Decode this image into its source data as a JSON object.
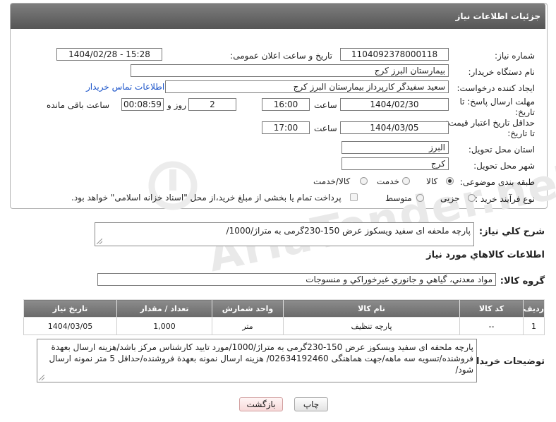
{
  "header": {
    "title": "جزئیات اطلاعات نیاز"
  },
  "fields": {
    "need_number_label": "شماره نیاز:",
    "need_number": "1104092378000118",
    "announce_label": "تاریخ و ساعت اعلان عمومی:",
    "announce_value": "1404/02/28 - 15:28",
    "buyer_org_label": "نام دستگاه خریدار:",
    "buyer_org": "بیمارستان البرز کرج",
    "creator_label": "ایجاد کننده درخواست:",
    "creator": "سعید سفیدگر کارپرداز بیمارستان البرز کرج",
    "contact_link": "اطلاعات تماس خریدار",
    "deadline_label_1": "مهلت ارسال پاسخ: تا",
    "deadline_label_2": "تاریخ:",
    "deadline_date": "1404/02/30",
    "time_label": "ساعت",
    "deadline_time": "16:00",
    "days_value": "2",
    "days_label": "روز و",
    "countdown": "00:08:59",
    "remaining_label": "ساعت باقی مانده",
    "min_price_label_1": "حداقل تاریخ اعتبار قیمت:",
    "min_price_label_2": "تا تاریخ:",
    "price_date": "1404/03/05",
    "price_time_label": "ساعت",
    "price_time": "17:00",
    "province_label": "استان محل تحویل:",
    "province": "البرز",
    "city_label": "شهر محل تحویل:",
    "city": "کرج",
    "category_label": "طبقه بندی موضوعی:",
    "category_options": [
      "کالا",
      "خدمت",
      "کالا/خدمت"
    ],
    "category_selected": "کالا",
    "process_label": "نوع فرآیند خرید :",
    "process_options": [
      "جزیی",
      "متوسط"
    ],
    "process_note": "پرداخت تمام یا بخشی از مبلغ خرید،از محل \"اسناد خزانه اسلامی\" خواهد بود."
  },
  "watermark": "AriaTender.neT",
  "description": {
    "label": "شرح کلي نياز:",
    "text": "پارچه ملحفه ای سفید ویسکوز عرض 150-230گرمی به متراژ/1000/"
  },
  "goods_section": {
    "title": "اطلاعات کالاهاي مورد نياز",
    "group_label": "گروه کالا:",
    "group_value": "مواد معدني، گياهي و جانوري غيرخوراکي و منسوجات"
  },
  "table": {
    "headers": [
      "ردیف",
      "کد کالا",
      "نام کالا",
      "واحد شمارش",
      "تعداد / مقدار",
      "تاریخ نیاز"
    ],
    "rows": [
      [
        "1",
        "--",
        "پارچه تنظیف",
        "متر",
        "1,000",
        "1404/03/05"
      ]
    ]
  },
  "buyer_notes": {
    "label": "توضیحات خریدار:",
    "text": "پارچه ملحفه ای سفید ویسکوز عرض 150-230گرمی به متراژ/1000/مورد تایید کارشناس مرکز باشد/هزینه ارسال بعهدة فروشنده/تسویه سه ماهه/جهت هماهنگی 02634192460/ هزینه ارسال نمونه بعهدة فروشنده/حداقل 5 متر نمونه ارسال شود/"
  },
  "buttons": {
    "print": "چاپ",
    "back": "بازگشت"
  }
}
